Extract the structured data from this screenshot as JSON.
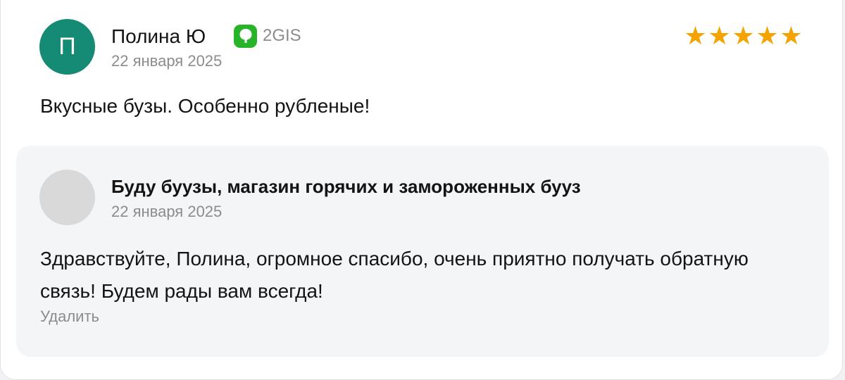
{
  "review": {
    "author_initial": "П",
    "author_name": "Полина Ю",
    "source_label": "2GIS",
    "source_icon": "2gis-icon",
    "source_color": "#28b329",
    "date": "22 января 2025",
    "rating": 5,
    "rating_max": 5,
    "star_color": "#f5a300",
    "text": "Вкусные бузы. Особенно рубленые!"
  },
  "reply": {
    "author_name": "Буду буузы, магазин горячих и замороженных бууз",
    "date": "22 января 2025",
    "text": "Здравствуйте, Полина, огромное спасибо, очень приятно получать обратную связь! Будем рады вам всегда!",
    "delete_label": "Удалить"
  },
  "colors": {
    "avatar_bg": "#158a74",
    "reply_bg": "#f4f5f7",
    "secondary_text": "#8c8c8c"
  }
}
